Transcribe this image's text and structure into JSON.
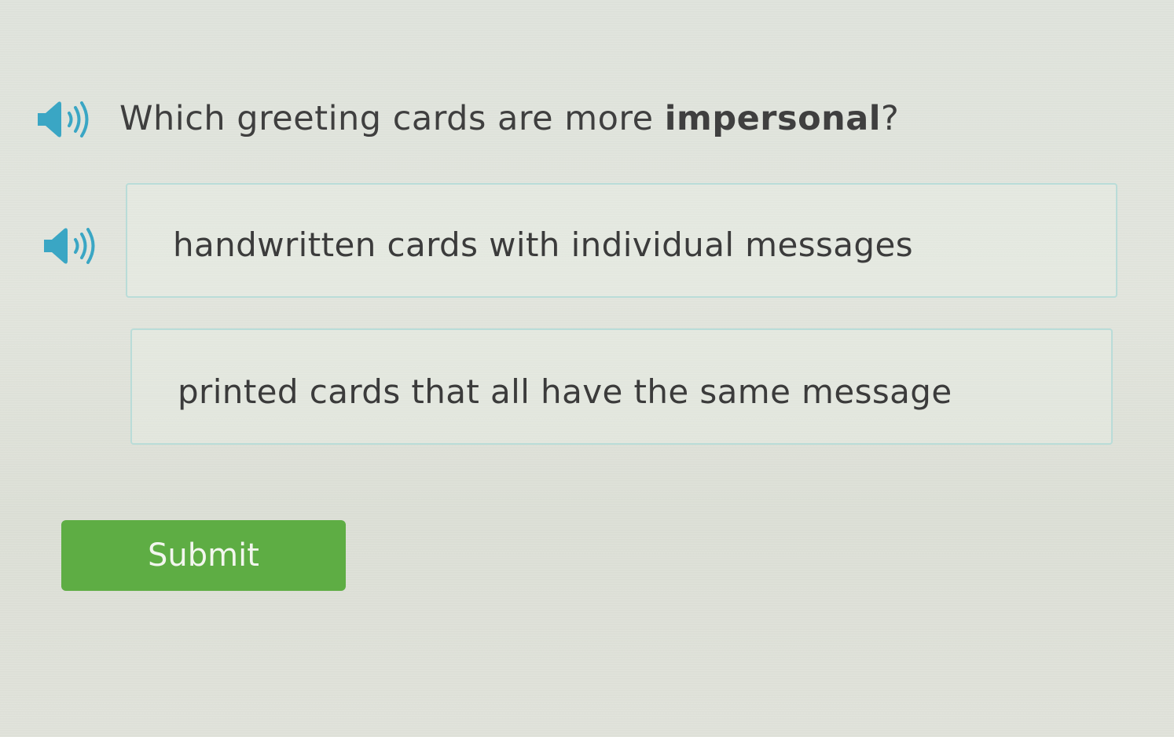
{
  "question": {
    "prefix": "Which greeting cards are more ",
    "emphasis": "impersonal",
    "suffix": "?"
  },
  "options": [
    {
      "text": "handwritten cards with individual messages"
    },
    {
      "text": "printed cards that all have the same message"
    }
  ],
  "submit_label": "Submit",
  "icons": {
    "question_audio": "speaker-icon",
    "option_audio": "speaker-icon"
  },
  "colors": {
    "accent_blue": "#3aa6c4",
    "submit_green": "#5ead44",
    "option_border": "#b9dcd8"
  }
}
